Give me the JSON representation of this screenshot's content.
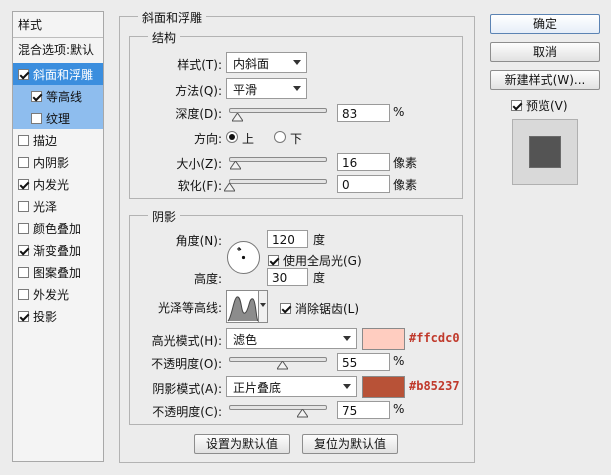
{
  "left": {
    "title": "样式",
    "blend_label": "混合选项:默认",
    "items": [
      {
        "label": "斜面和浮雕",
        "checked": true
      },
      {
        "label": "等高线",
        "checked": true
      },
      {
        "label": "纹理",
        "checked": false
      },
      {
        "label": "描边",
        "checked": false
      },
      {
        "label": "内阴影",
        "checked": false
      },
      {
        "label": "内发光",
        "checked": true
      },
      {
        "label": "光泽",
        "checked": false
      },
      {
        "label": "颜色叠加",
        "checked": false
      },
      {
        "label": "渐变叠加",
        "checked": true
      },
      {
        "label": "图案叠加",
        "checked": false
      },
      {
        "label": "外发光",
        "checked": false
      },
      {
        "label": "投影",
        "checked": true
      }
    ]
  },
  "bevel": {
    "group_title": "斜面和浮雕",
    "structure": {
      "title": "结构",
      "style_label": "样式(T):",
      "style_value": "内斜面",
      "method_label": "方法(Q):",
      "method_value": "平滑",
      "depth_label": "深度(D):",
      "depth_value": "83",
      "depth_unit": "%",
      "depth_level": 0.083,
      "direction_label": "方向:",
      "direction_up": "上",
      "direction_down": "下",
      "size_label": "大小(Z):",
      "size_value": "16",
      "size_unit": "像素",
      "size_level": 0.065,
      "soften_label": "软化(F):",
      "soften_value": "0",
      "soften_unit": "像素",
      "soften_level": 0.0
    },
    "shading": {
      "title": "阴影",
      "angle_label": "角度(N):",
      "angle_value": "120",
      "angle_unit": "度",
      "global_light_label": "使用全局光(G)",
      "altitude_label": "高度:",
      "altitude_value": "30",
      "altitude_unit": "度",
      "gloss_label": "光泽等高线:",
      "antialias_label": "消除锯齿(L)",
      "highlight_mode_label": "高光模式(H):",
      "highlight_mode_value": "滤色",
      "highlight_color": "#ffcdc0",
      "highlight_hex": "#ffcdc0",
      "highlight_opacity_label": "不透明度(O):",
      "highlight_opacity_value": "55",
      "highlight_opacity_unit": "%",
      "highlight_opacity_level": 0.55,
      "shadow_mode_label": "阴影模式(A):",
      "shadow_mode_value": "正片叠底",
      "shadow_color": "#b85237",
      "shadow_hex": "#b85237",
      "shadow_opacity_label": "不透明度(C):",
      "shadow_opacity_value": "75",
      "shadow_opacity_unit": "%",
      "shadow_opacity_level": 0.75
    },
    "set_default_label": "设置为默认值",
    "reset_default_label": "复位为默认值"
  },
  "right": {
    "ok_label": "确定",
    "cancel_label": "取消",
    "new_style_label": "新建样式(W)...",
    "preview_label": "预览(V)"
  }
}
